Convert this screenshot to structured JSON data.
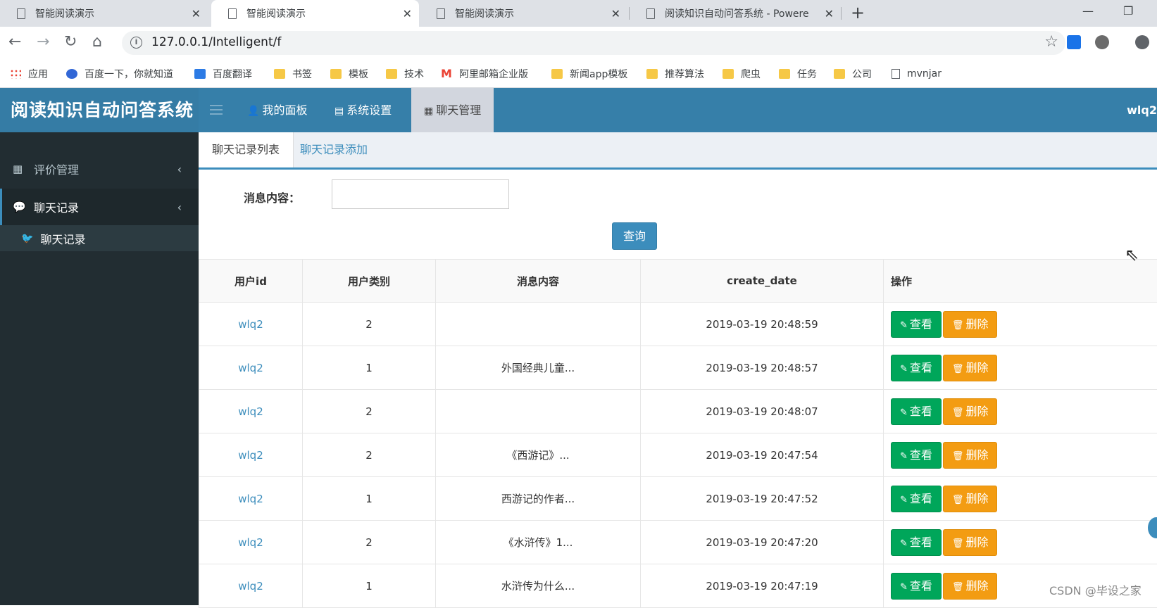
{
  "browser": {
    "tabs": [
      {
        "title": "智能阅读演示"
      },
      {
        "title": "智能阅读演示"
      },
      {
        "title": "智能阅读演示"
      },
      {
        "title": "阅读知识自动问答系统 - Powere"
      }
    ],
    "url": "127.0.0.1/Intelligent/f",
    "bookmarks": [
      "应用",
      "百度一下，你就知道",
      "百度翻译",
      "书签",
      "模板",
      "技术",
      "阿里邮箱企业版",
      "新闻app模板",
      "推荐算法",
      "爬虫",
      "任务",
      "公司",
      "mvnjar"
    ]
  },
  "header": {
    "logo": "阅读知识自动问答系统",
    "nav": [
      {
        "label": "我的面板",
        "icon": "user-icon"
      },
      {
        "label": "系统设置",
        "icon": "list-icon"
      },
      {
        "label": "聊天管理",
        "icon": "grid-icon"
      }
    ],
    "user": "wlq2"
  },
  "sidebar": {
    "menus": [
      {
        "label": "评价管理",
        "icon": "grid-icon"
      },
      {
        "label": "聊天记录",
        "icon": "comments-icon"
      }
    ],
    "submenu": {
      "label": "聊天记录",
      "icon": "twitter-icon"
    }
  },
  "content": {
    "tabs": [
      "聊天记录列表",
      "聊天记录添加"
    ],
    "filter_label": "消息内容：",
    "filter_value": "",
    "query_button": "查询",
    "columns": [
      "用户id",
      "用户类别",
      "消息内容",
      "create_date",
      "操作"
    ],
    "rows": [
      {
        "uid": "wlq2",
        "type": "2",
        "msg": "",
        "date": "2019-03-19 20:48:59"
      },
      {
        "uid": "wlq2",
        "type": "1",
        "msg": "外国经典儿童...",
        "date": "2019-03-19 20:48:57"
      },
      {
        "uid": "wlq2",
        "type": "2",
        "msg": "",
        "date": "2019-03-19 20:48:07"
      },
      {
        "uid": "wlq2",
        "type": "2",
        "msg": "《西游记》...",
        "date": "2019-03-19 20:47:54"
      },
      {
        "uid": "wlq2",
        "type": "1",
        "msg": "西游记的作者...",
        "date": "2019-03-19 20:47:52"
      },
      {
        "uid": "wlq2",
        "type": "2",
        "msg": "《水浒传》1...",
        "date": "2019-03-19 20:47:20"
      },
      {
        "uid": "wlq2",
        "type": "1",
        "msg": "水浒传为什么...",
        "date": "2019-03-19 20:47:19"
      }
    ],
    "view_label": "查看",
    "delete_label": "删除"
  },
  "watermark": "CSDN @毕设之家",
  "colors": {
    "header": "#367fa9",
    "sidebar": "#222d32",
    "view": "#00a65a",
    "delete": "#f39c12",
    "link": "#3c8dbc"
  }
}
